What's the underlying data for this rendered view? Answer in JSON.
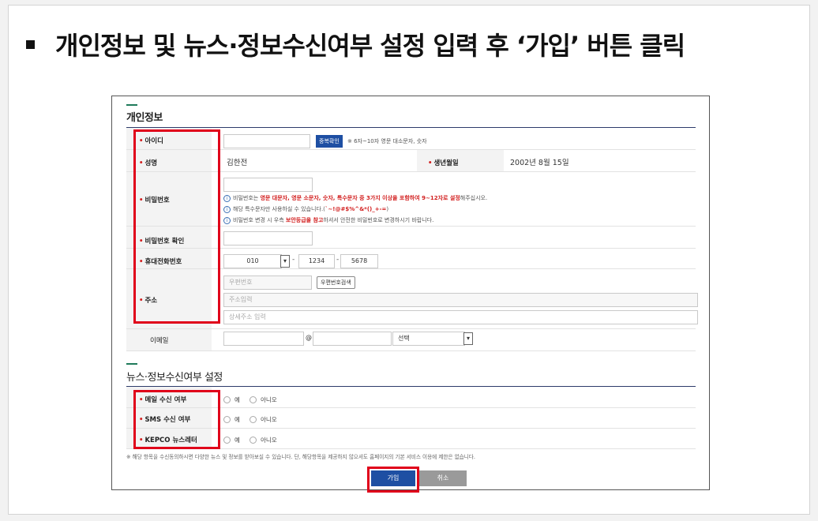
{
  "slide": {
    "title": "개인정보 및 뉴스·정보수신여부 설정 입력 후 ‘가입’ 버튼 클릭"
  },
  "personal": {
    "section_title": "개인정보",
    "id": {
      "label": "아이디",
      "value": "",
      "check_button": "중복확인",
      "hint": "※ 6자~10자 영문 대소문자, 숫자"
    },
    "name": {
      "label": "성명",
      "value": "김한전"
    },
    "birth": {
      "label": "생년월일",
      "value": "2002년  8월  15일"
    },
    "password": {
      "label": "비밀번호",
      "value": "",
      "notes": [
        {
          "pre": "비밀번호는 ",
          "em": "영문 대문자, 영문 소문자, 숫자, 특수문자 중 3가지 이상을 포함하여 9~12자로 설정",
          "post": "해주십시오."
        },
        {
          "pre": "해당 특수문자만 사용하실 수 있습니다.(",
          "em": "`~!@#$%^&*()_+-=",
          "post": ")"
        },
        {
          "pre": "비밀번호 변경 시 우측 ",
          "em": "보안등급을 참고",
          "post": "하셔서 안전한 비밀번호로 변경하시기 바랍니다."
        }
      ]
    },
    "password_confirm": {
      "label": "비밀번호 확인",
      "value": ""
    },
    "phone": {
      "label": "휴대전화번호",
      "first": "010",
      "middle": "1234",
      "last": "5678"
    },
    "address": {
      "label": "주소",
      "zip_placeholder": "우편번호",
      "zip_button": "우편번호검색",
      "addr_placeholder": "주소입력",
      "detail_placeholder": "상세주소 입력"
    },
    "email": {
      "label": "이메일",
      "at": "@",
      "domain_select": "선택"
    }
  },
  "news": {
    "section_title": "뉴스·정보수신여부 설정",
    "rows": [
      {
        "label": "메일 수신 여부",
        "yes": "예",
        "no": "아니오"
      },
      {
        "label": "SMS 수신 여부",
        "yes": "예",
        "no": "아니오"
      },
      {
        "label": "KEPCO 뉴스레터",
        "yes": "예",
        "no": "아니오"
      }
    ],
    "footnote": "※ 해당 항목을 수신동의하시면 다양한 뉴스 및 정보를 받아보실 수 있습니다. 단, 해당항목을 제공하지 않으셔도 홈페이지의 기본 서비스 이용에 제한은 없습니다."
  },
  "actions": {
    "submit": "가입",
    "cancel": "취소"
  },
  "colors": {
    "accent": "#1e4fa3",
    "highlight": "#e0001a",
    "required": "#d21f1f"
  }
}
